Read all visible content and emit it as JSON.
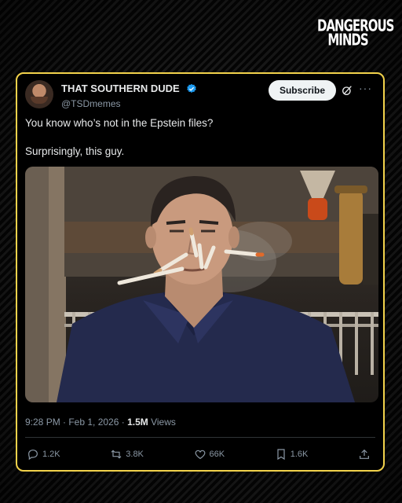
{
  "watermark": {
    "line1": "DANGEROUS",
    "line2": "MINDS"
  },
  "post": {
    "display_name": "THAT SOUTHERN DUDE",
    "handle": "@TSDmemes",
    "verified": true,
    "subscribe_label": "Subscribe",
    "more_label": "···",
    "text_line1": "You know who’s not in the Epstein files?",
    "text_line2": "Surprisingly, this guy.",
    "timestamp": "9:28 PM · Feb 1, 2026 · ",
    "views_count": "1.5M",
    "views_label": " Views"
  },
  "actions": {
    "replies": "1.2K",
    "reposts": "3.8K",
    "likes": "66K",
    "bookmarks": "1.6K"
  },
  "colors": {
    "card_border": "#f2d24b",
    "verified_blue": "#1d9bf0",
    "muted_text": "#8b98a5",
    "shirt_navy": "#242a4d"
  }
}
